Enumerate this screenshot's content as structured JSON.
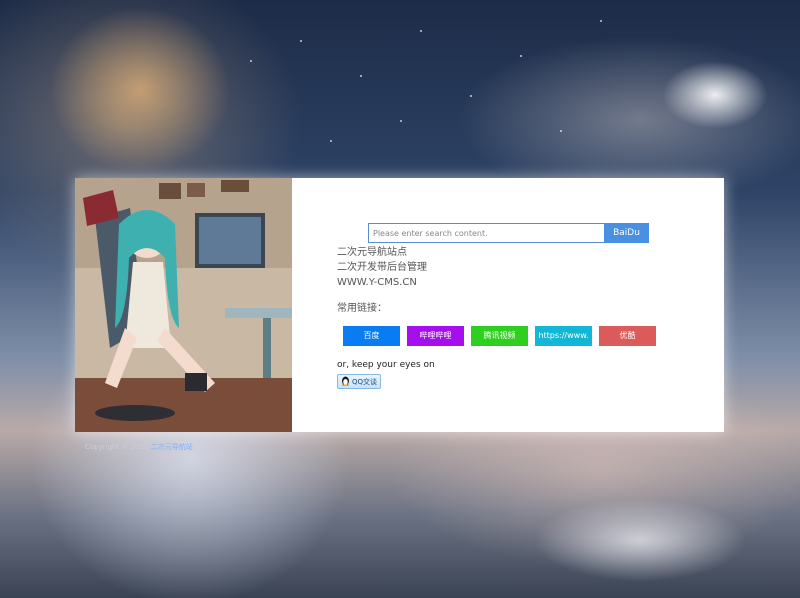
{
  "search": {
    "placeholder": "Please enter search content.",
    "value": "",
    "button_label": "BaiDu"
  },
  "site_info": {
    "line1": "二次元导航站点",
    "line2": "二次开发带后台管理",
    "line3": "WWW.Y-CMS.CN"
  },
  "links": {
    "title": "常用链接：",
    "items": [
      {
        "label": "百度",
        "color": "#0a7cf2"
      },
      {
        "label": "哔哩哔哩",
        "color": "#a50ff0"
      },
      {
        "label": "腾讯视频",
        "color": "#2ecf1e"
      },
      {
        "label": "https://www.",
        "color": "#11b7d4"
      },
      {
        "label": "优酷",
        "color": "#db5a5a"
      }
    ]
  },
  "contact": {
    "tagline": "or, keep your eyes on",
    "qq_badge_label": "QQ交谈"
  },
  "footer": {
    "copyright_text": "Copyright © 2021",
    "copyright_link": "二次元导航站"
  },
  "colors": {
    "search_border": "#5b8ec9",
    "search_button": "#4a90e2",
    "card_background": "#ffffff"
  }
}
